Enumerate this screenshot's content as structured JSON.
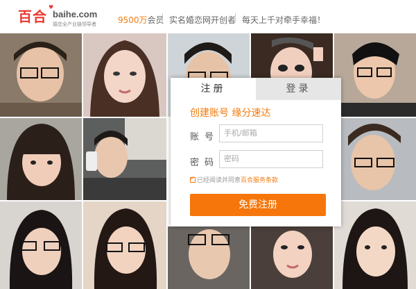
{
  "header": {
    "logo_cn": "百合",
    "logo_en": "baihe.com",
    "logo_sub": "婚恋全产业链领导者",
    "stat_number": "9500万",
    "stat_suffix": "会员",
    "claim": "实名婚恋网开创者",
    "wish": "每天上千对牵手幸福！"
  },
  "form": {
    "tab_register": "注册",
    "tab_login": "登录",
    "slogan": "创建账号  缘分速达",
    "account_label": "账号",
    "account_placeholder": "手机/邮箱",
    "password_label": "密码",
    "password_placeholder": "密码",
    "agree_text": "已经阅读并同意",
    "terms_link": "百合服务条款",
    "submit_label": "免费注册"
  },
  "colors": {
    "brand_red": "#e8382f",
    "accent_orange": "#f6760b"
  }
}
